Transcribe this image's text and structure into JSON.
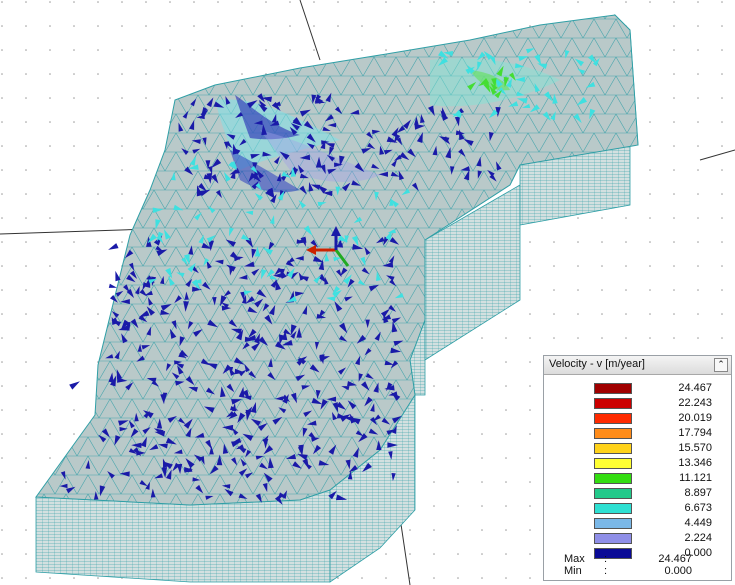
{
  "legend": {
    "title": "Velocity - v [m/year]",
    "collapse_icon": "double-chevron-up-icon",
    "items": [
      {
        "value": "24.467",
        "color": "#a00000"
      },
      {
        "value": "22.243",
        "color": "#cc0000"
      },
      {
        "value": "20.019",
        "color": "#ff2a00"
      },
      {
        "value": "17.794",
        "color": "#ff8c1a"
      },
      {
        "value": "15.570",
        "color": "#ffd21a"
      },
      {
        "value": "13.346",
        "color": "#ffff33"
      },
      {
        "value": "11.121",
        "color": "#33dd11"
      },
      {
        "value": "8.897",
        "color": "#22c98a"
      },
      {
        "value": "6.673",
        "color": "#2ee0d2"
      },
      {
        "value": "4.449",
        "color": "#7ab8e8"
      },
      {
        "value": "2.224",
        "color": "#8f8fe8"
      },
      {
        "value": "0.000",
        "color": "#0a0a96"
      }
    ],
    "max_label": "Max",
    "max_sep": ":",
    "max_value": "24.467",
    "min_label": "Min",
    "min_sep": ":",
    "min_value": "0.000"
  },
  "colors": {
    "mesh_fill": "#b7c7c7",
    "mesh_line": "#2f9fa6",
    "side_fill": "#cfdede",
    "arrow_low": "#1a1aa8",
    "arrow_mid": "#3fe0e0",
    "arrow_green": "#44dd33",
    "axis_x": "#cc2200",
    "axis_y": "#22aa22"
  }
}
